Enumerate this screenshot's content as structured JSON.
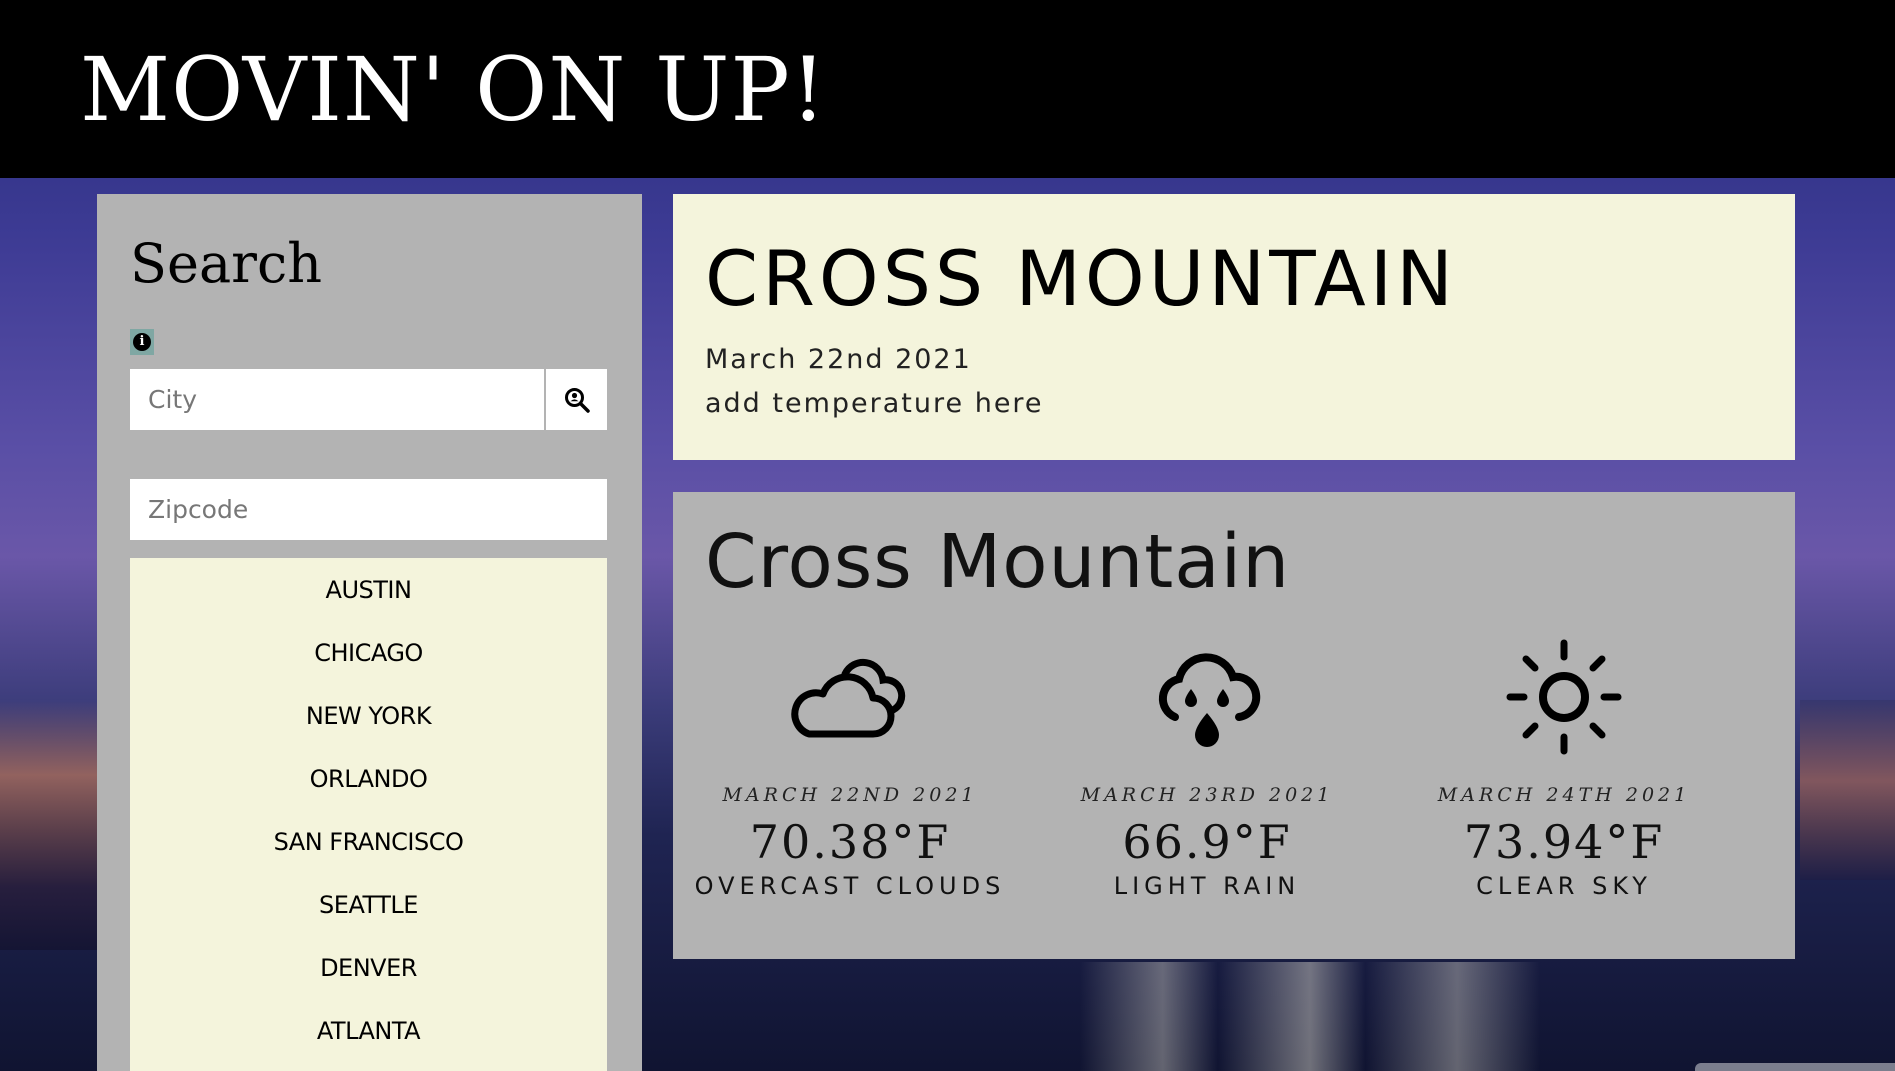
{
  "header": {
    "title": "MOVIN' ON UP!"
  },
  "search": {
    "heading": "Search",
    "city_placeholder": "City",
    "zip_placeholder": "Zipcode",
    "cities": [
      "AUSTIN",
      "CHICAGO",
      "NEW YORK",
      "ORLANDO",
      "SAN FRANCISCO",
      "SEATTLE",
      "DENVER",
      "ATLANTA"
    ]
  },
  "current": {
    "city": "CROSS MOUNTAIN",
    "date": "March 22nd 2021",
    "temperature": "add temperature here"
  },
  "forecast": {
    "city": "Cross Mountain",
    "days": [
      {
        "date": "MARCH 22ND 2021",
        "temp": "70.38°F",
        "desc": "OVERCAST CLOUDS",
        "icon": "overcast-clouds-icon"
      },
      {
        "date": "MARCH 23RD 2021",
        "temp": "66.9°F",
        "desc": "LIGHT RAIN",
        "icon": "light-rain-icon"
      },
      {
        "date": "MARCH 24TH 2021",
        "temp": "73.94°F",
        "desc": "CLEAR SKY",
        "icon": "clear-sky-icon"
      }
    ]
  }
}
